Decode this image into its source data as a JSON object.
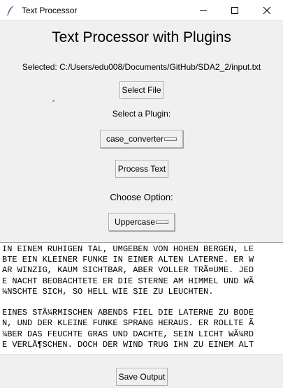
{
  "window": {
    "title": "Text Processor",
    "icon": "feather-icon"
  },
  "main": {
    "heading": "Text Processor with Plugins",
    "selected_path": "Selected: C:/Users/edu008/Documents/GitHub/SDA2_2/input.txt",
    "select_file_label": "Select File",
    "plugin_prompt": "Select a Plugin:",
    "plugin_value": "case_converter",
    "process_label": "Process Text",
    "option_prompt": "Choose Option:",
    "option_value": "Uppercase",
    "save_label": "Save Output"
  },
  "output": {
    "lines": [
      "IN EINEM RUHIGEN TAL, UMGEBEN VON HOHEN BERGEN, LE",
      "BTE EIN KLEINER FUNKE IN EINER ALTEN LATERNE. ER W",
      "AR WINZIG, KAUM SICHTBAR, ABER VOLLER TRÃ¤UME. JED",
      "E NACHT BEOBACHTETE ER DIE STERNE AM HIMMEL UND WÃ",
      "¼NSCHTE SICH, SO HELL WIE SIE ZU LEUCHTEN.",
      "",
      "EINES STÃ¼RMISCHEN ABENDS FIEL DIE LATERNE ZU BODE",
      "N, UND DER KLEINE FUNKE SPRANG HERAUS. ER ROLLTE Ã",
      "¼BER DAS FEUCHTE GRAS UND DACHTE, SEIN LICHT WÃ¼RD",
      "E VERLÃ¶SCHEN. DOCH DER WIND TRUG IHN ZU EINEM ALT"
    ]
  }
}
